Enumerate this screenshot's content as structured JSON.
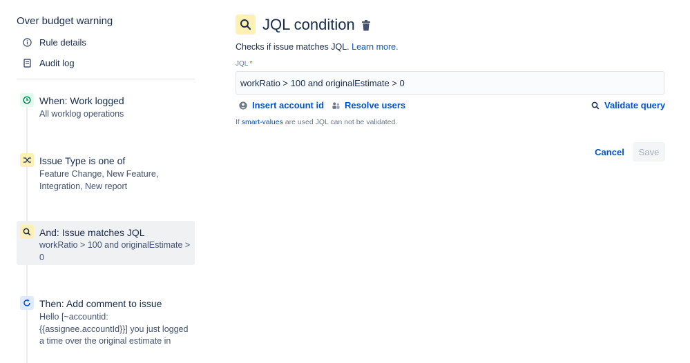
{
  "sidebar": {
    "rule_name": "Over budget warning",
    "links": [
      {
        "label": "Rule details",
        "icon": "info-icon"
      },
      {
        "label": "Audit log",
        "icon": "document-icon"
      }
    ],
    "components": [
      {
        "title": "When: Work logged",
        "desc": "All worklog operations",
        "icon": "clock-icon",
        "color": "#e3fcef"
      },
      {
        "title": "Issue Type is one of",
        "desc": "Feature Change, New Feature, Integration, New report",
        "icon": "shuffle-icon",
        "color": "#fff0b3"
      },
      {
        "title": "And: Issue matches JQL",
        "desc": "workRatio > 100 and originalEstimate > 0",
        "icon": "search-icon",
        "color": "#fff0b3"
      },
      {
        "title": "Then: Add comment to issue",
        "desc": "Hello [~accountid: {{assignee.accountId}}] you just logged a time over the original estimate in",
        "icon": "refresh-icon",
        "color": "#deebff"
      }
    ]
  },
  "main": {
    "title": "JQL condition",
    "help_text": "Checks if issue matches JQL.",
    "learn_more": "Learn more.",
    "jql_label": "JQL",
    "required_mark": "*",
    "jql_value": "workRatio > 100 and originalEstimate > 0",
    "insert_account_id": "Insert account id",
    "resolve_users": "Resolve users",
    "validate_query": "Validate query",
    "note_prefix": "If",
    "note_link": "smart-values",
    "note_suffix": "are used JQL can not be validated.",
    "cancel": "Cancel",
    "save": "Save"
  },
  "colors": {
    "accent": "#0052cc",
    "jql_icon_bg": "#fff0b3",
    "active_component_bg": "#f0f1f3"
  }
}
